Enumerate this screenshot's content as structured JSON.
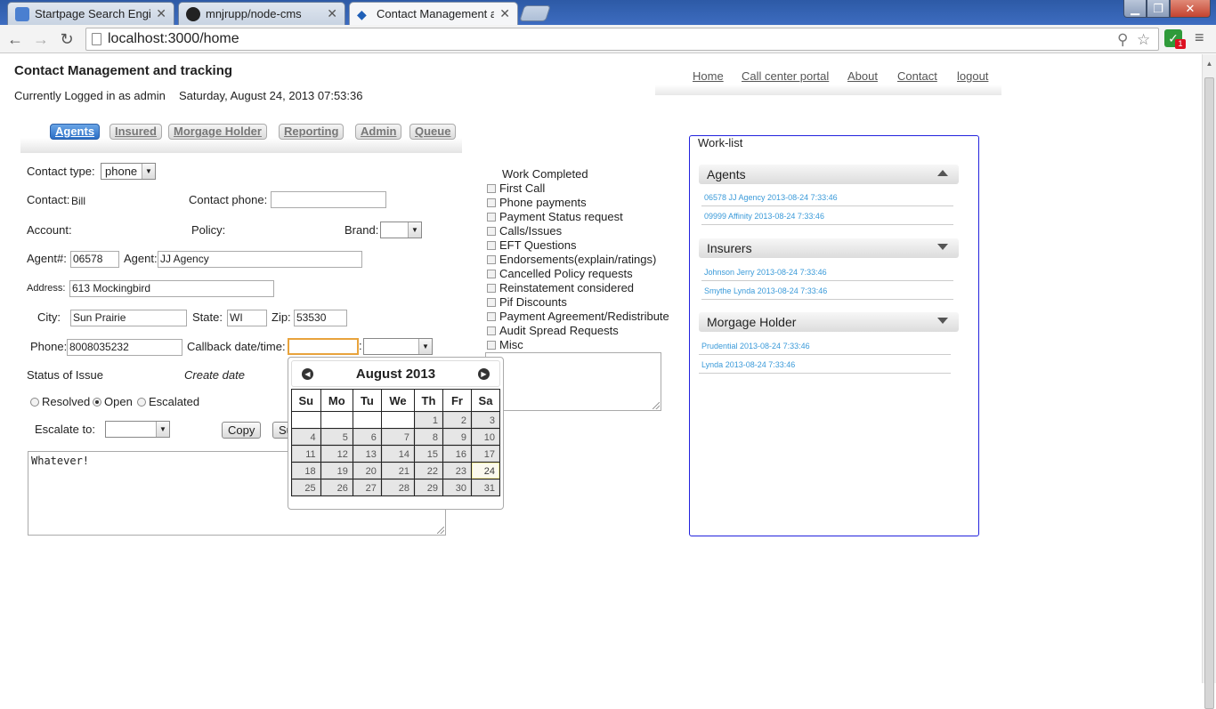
{
  "browser": {
    "tabs": [
      {
        "title": "Startpage Search Engine",
        "active": false
      },
      {
        "title": "mnjrupp/node-cms",
        "active": false
      },
      {
        "title": "Contact Management and",
        "active": true
      }
    ],
    "address": "localhost:3000/home",
    "extension_badge": "1"
  },
  "header": {
    "title": "Contact Management and tracking",
    "logged_in": "Currently Logged in as admin",
    "datetime": "Saturday, August 24, 2013 07:53:36"
  },
  "topnav": [
    "Home",
    "Call center portal",
    "About",
    "Contact",
    "logout"
  ],
  "tabs": [
    "Agents",
    "Insured",
    "Morgage Holder",
    "Reporting",
    "Admin",
    "Queue"
  ],
  "form": {
    "contact_type_label": "Contact type:",
    "contact_type_value": "phone",
    "contact_label": "Contact:",
    "contact_value": "Bill",
    "contact_phone_label": "Contact phone:",
    "contact_phone_value": "",
    "account_label": "Account:",
    "policy_label": "Policy:",
    "brand_label": "Brand:",
    "brand_value": "",
    "agent_num_label": "Agent#:",
    "agent_num_value": "06578",
    "agent_label": "Agent:",
    "agent_value": "JJ Agency",
    "address_label": "Address:",
    "address_value": "613 Mockingbird",
    "city_label": "City:",
    "city_value": "Sun Prairie",
    "state_label": "State:",
    "state_value": "WI",
    "zip_label": "Zip:",
    "zip_value": "53530",
    "phone_label": "Phone:",
    "phone_value": "8008035232",
    "callback_label": "Callback date/time:",
    "callback_date": "",
    "callback_time": "",
    "colon": ":",
    "status_label": "Status of Issue",
    "create_date_label": "Create date",
    "status_options": [
      {
        "label": "Resolved",
        "checked": false
      },
      {
        "label": "Open",
        "checked": true
      },
      {
        "label": "Escalated",
        "checked": false
      }
    ],
    "escalate_label": "Escalate to:",
    "escalate_value": "",
    "copy_button": "Copy",
    "submit_button_partial": "Su",
    "notes": "Whatever!"
  },
  "work_completed": {
    "title": "Work Completed",
    "items": [
      "First Call",
      "Phone payments",
      "Payment Status request",
      "Calls/Issues",
      "EFT Questions",
      "Endorsements(explain/ratings)",
      "Cancelled Policy requests",
      "Reinstatement considered",
      "Pif Discounts",
      "Payment Agreement/Redistribute",
      "Audit Spread Requests",
      "Misc"
    ],
    "notes": ""
  },
  "datepicker": {
    "title": "August 2013",
    "prev": "Prev",
    "next": "Next",
    "weekdays": [
      "Su",
      "Mo",
      "Tu",
      "We",
      "Th",
      "Fr",
      "Sa"
    ],
    "weeks": [
      [
        "",
        "",
        "",
        "",
        "1",
        "2",
        "3"
      ],
      [
        "4",
        "5",
        "6",
        "7",
        "8",
        "9",
        "10"
      ],
      [
        "11",
        "12",
        "13",
        "14",
        "15",
        "16",
        "17"
      ],
      [
        "18",
        "19",
        "20",
        "21",
        "22",
        "23",
        "24"
      ],
      [
        "25",
        "26",
        "27",
        "28",
        "29",
        "30",
        "31"
      ]
    ],
    "today": "24"
  },
  "worklist": {
    "title": "Work-list",
    "sections": [
      {
        "name": "Agents",
        "expanded": true,
        "items": [
          "06578 JJ Agency 2013-08-24 7:33:46",
          "09999 Affinity 2013-08-24 7:33:46"
        ]
      },
      {
        "name": "Insurers",
        "expanded": false,
        "items": [
          "Johnson Jerry 2013-08-24 7:33:46",
          "Smythe Lynda 2013-08-24 7:33:46"
        ]
      },
      {
        "name": "Morgage Holder",
        "expanded": false,
        "items": [
          "Prudential 2013-08-24 7:33:46",
          "Lynda 2013-08-24 7:33:46"
        ]
      }
    ]
  }
}
